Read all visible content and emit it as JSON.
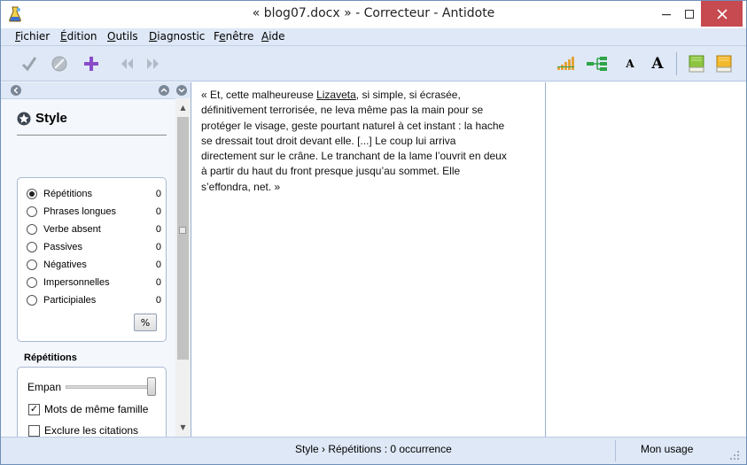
{
  "window": {
    "title": "« blog07.docx » - Correcteur - Antidote",
    "accent_close": "#c74a50"
  },
  "menu": {
    "items": [
      {
        "label": "Fichier",
        "accel": "F",
        "rest": "ichier"
      },
      {
        "label": "Édition",
        "accel": "É",
        "rest": "dition"
      },
      {
        "label": "Outils",
        "accel": "O",
        "rest": "utils"
      },
      {
        "label": "Diagnostic",
        "accel": "D",
        "rest": "iagnostic"
      },
      {
        "label": "Fenêtre",
        "accel": "e",
        "pre": "F",
        "rest": "nêtre"
      },
      {
        "label": "Aide",
        "accel": "A",
        "rest": "ide"
      }
    ]
  },
  "toolbar": {
    "icons": [
      "checkmark-icon",
      "forbidden-icon",
      "add-icon",
      "previous-icon",
      "next-icon",
      "signal-bars-icon",
      "tree-icon",
      "font-small-icon",
      "font-large-icon",
      "dictionary-green-icon",
      "dictionary-yellow-icon"
    ],
    "font_small": "A",
    "font_large": "A"
  },
  "style_panel": {
    "title": "Style",
    "options": [
      {
        "label": "Répétitions",
        "count": "0",
        "selected": true
      },
      {
        "label": "Phrases longues",
        "count": "0",
        "selected": false
      },
      {
        "label": "Verbe absent",
        "count": "0",
        "selected": false
      },
      {
        "label": "Passives",
        "count": "0",
        "selected": false
      },
      {
        "label": "Négatives",
        "count": "0",
        "selected": false
      },
      {
        "label": "Impersonnelles",
        "count": "0",
        "selected": false
      },
      {
        "label": "Participiales",
        "count": "0",
        "selected": false
      }
    ],
    "percent_button": "%",
    "repetitions": {
      "title": "Répétitions",
      "empan_label": "Empan",
      "empan_level": 1.0,
      "same_family_label": "Mots de même famille",
      "same_family_checked": true,
      "exclude_quotes_label": "Exclure les citations",
      "exclude_quotes_checked": false
    }
  },
  "editor": {
    "lines": [
      "« Et, cette malheureuse ",
      "Lizaveta",
      ", si simple, si écrasée,",
      "définitivement terrorisée, ne leva même pas la main pour se",
      "protéger le visage, geste pourtant naturel à cet instant : la hache",
      "se dressait tout droit devant elle. [...] Le coup lui arriva",
      "directement sur le crâne. Le tranchant de la lame l’ouvrit en deux",
      "à partir du haut du front presque jusqu’au sommet. Elle",
      "s’effondra, net. »"
    ]
  },
  "status": {
    "text": "Style › Répétitions : 0 occurrence",
    "usage": "Mon usage"
  }
}
